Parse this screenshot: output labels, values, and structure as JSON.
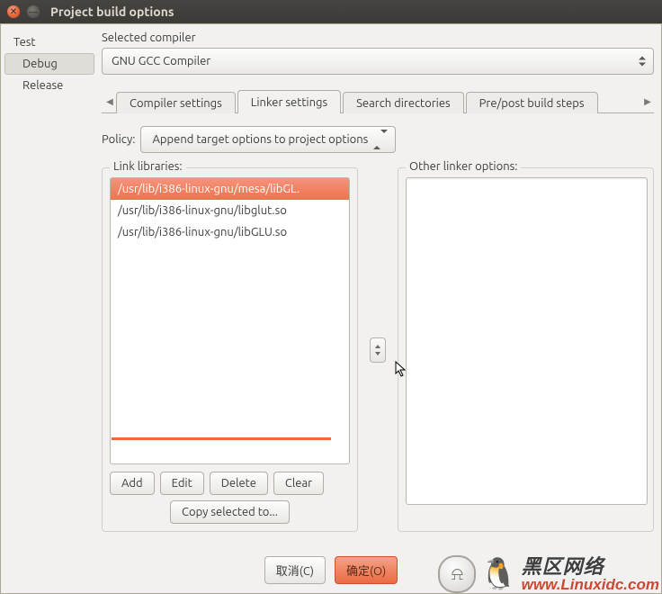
{
  "window": {
    "title": "Project build options"
  },
  "sidebar": {
    "root": "Test",
    "items": [
      "Debug",
      "Release"
    ],
    "selected_index": 0
  },
  "compiler": {
    "label": "Selected compiler",
    "value": "GNU GCC Compiler"
  },
  "tabs": {
    "items": [
      "Compiler settings",
      "Linker settings",
      "Search directories",
      "Pre/post build steps"
    ],
    "active_index": 1
  },
  "policy": {
    "label": "Policy:",
    "value": "Append target options to project options"
  },
  "linker": {
    "link_label": "Link libraries:",
    "other_label": "Other linker options:",
    "libraries": [
      "/usr/lib/i386-linux-gnu/mesa/libGL.",
      "/usr/lib/i386-linux-gnu/libglut.so",
      "/usr/lib/i386-linux-gnu/libGLU.so"
    ],
    "selected_library_index": 0,
    "buttons": {
      "add": "Add",
      "edit": "Edit",
      "delete": "Delete",
      "clear": "Clear",
      "copy": "Copy selected to..."
    }
  },
  "footer": {
    "cancel": "取消(C)",
    "ok": "确定(O)"
  },
  "watermark": {
    "cn": "黑区网络",
    "url": "www.Linuxidc.com"
  }
}
